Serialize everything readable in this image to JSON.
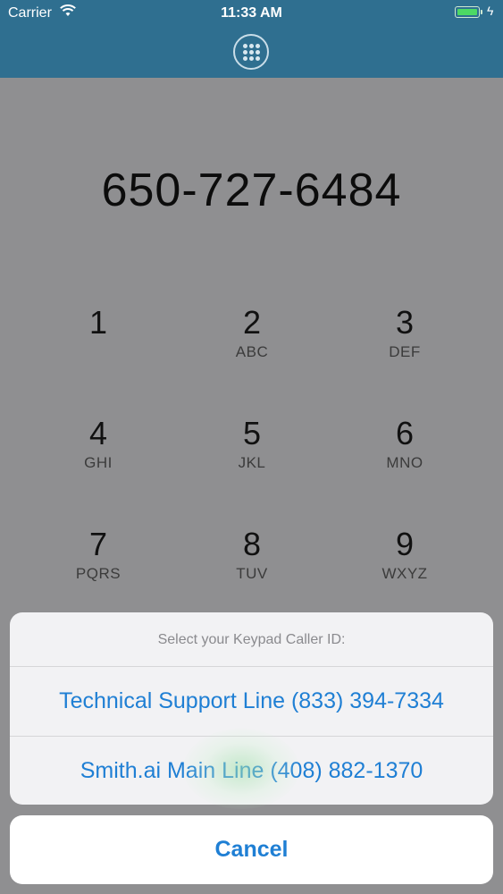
{
  "status_bar": {
    "carrier": "Carrier",
    "time": "11:33 AM",
    "battery_color": "#4cd964"
  },
  "header": {
    "keypad_icon": "keypad-grid-icon",
    "background_color": "#2f6f90"
  },
  "dialer": {
    "number": "650-727-6484",
    "keys": [
      {
        "digit": "1",
        "letters": ""
      },
      {
        "digit": "2",
        "letters": "ABC"
      },
      {
        "digit": "3",
        "letters": "DEF"
      },
      {
        "digit": "4",
        "letters": "GHI"
      },
      {
        "digit": "5",
        "letters": "JKL"
      },
      {
        "digit": "6",
        "letters": "MNO"
      },
      {
        "digit": "7",
        "letters": "PQRS"
      },
      {
        "digit": "8",
        "letters": "TUV"
      },
      {
        "digit": "9",
        "letters": "WXYZ"
      }
    ]
  },
  "action_sheet": {
    "title": "Select your Keypad Caller ID:",
    "options": [
      {
        "label": "Technical Support Line (833) 394-7334"
      },
      {
        "label": "Smith.ai Main Line (408) 882-1370"
      }
    ],
    "cancel_label": "Cancel",
    "accent_color": "#1f7fd4"
  }
}
